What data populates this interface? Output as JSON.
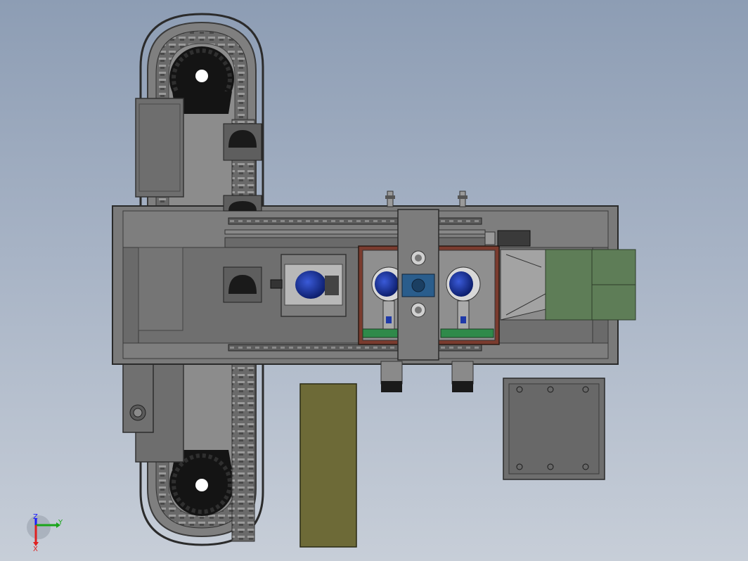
{
  "triad": {
    "z_label": "Z",
    "y_label": "Y",
    "x_label": "X",
    "z_color": "#1a1aff",
    "y_color": "#1aa51a",
    "x_color": "#e02020"
  },
  "palette": {
    "background_top": "#8d9db4",
    "background_bottom": "#c7ced8",
    "frame_gray": "#777777",
    "dark_gray": "#555555",
    "motor_blue": "#1f3aa8",
    "hopper_green": "#5e7d57",
    "olive_plate": "#6d6a37",
    "red_mount": "#7a3b2e"
  },
  "components": [
    "upper-sprocket",
    "lower-sprocket",
    "chain-conveyor",
    "main-frame",
    "top-rail",
    "bottom-rail",
    "center-gearbox",
    "motor-1",
    "motor-2",
    "motor-3",
    "hopper",
    "base-plate",
    "olive-plate"
  ]
}
